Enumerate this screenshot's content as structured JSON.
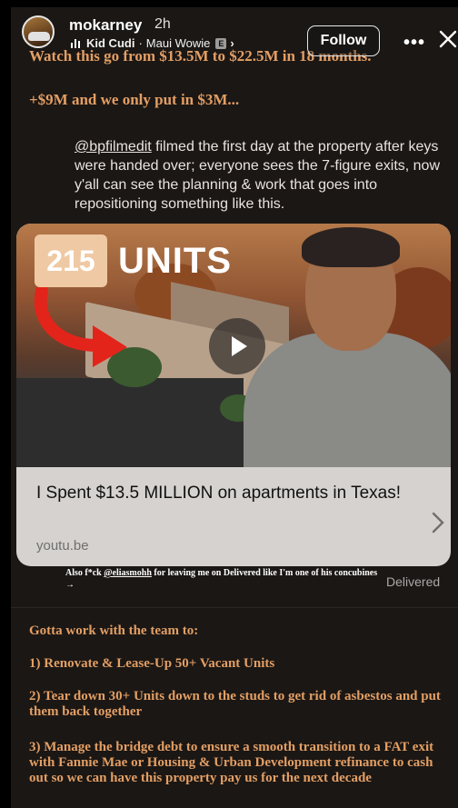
{
  "header": {
    "username": "mokarney",
    "time": "2h",
    "music_artist": "Kid Cudi",
    "music_separator": "·",
    "music_track": "Maui Wowie",
    "explicit_badge": "E",
    "music_chevron": "›",
    "follow_label": "Follow",
    "more_glyph": "•••",
    "icons": [
      "avatar",
      "music-bars-icon",
      "explicit-icon",
      "more-icon",
      "close-icon"
    ]
  },
  "post": {
    "headline": "Watch this go from $13.5M to $22.5M in 18 months.",
    "subline": "+$9M and we only put in $3M...",
    "quote_mention": "@bpfilmedit",
    "quote_body": " filmed the first day at the property after keys were handed over; everyone sees the 7-figure exits, now y'all can see the planning & work that goes into repositioning something like this."
  },
  "youtube_card": {
    "badge_number": "215",
    "badge_label": "UNITS",
    "title": "I Spent $13.5 MILLION on apartments in Texas!",
    "domain": "youtu.be",
    "icons": [
      "red-arrow-icon",
      "play-icon",
      "chevron-right-icon"
    ]
  },
  "caption": {
    "prefix": "Also f*ck ",
    "mention": "@eliasmohh",
    "suffix": " for leaving me on Delivered like I'm one of his concubines →",
    "delivered": "Delivered"
  },
  "list": {
    "intro": "Gotta work with the team to:",
    "items": [
      "1) Renovate & Lease-Up 50+ Vacant Units",
      "2) Tear down 30+ Units down to the studs to get rid of asbestos and put them back together",
      "3) Manage the bridge debt to ensure a smooth transition to a FAT exit with Fannie Mae or Housing & Urban Development refinance to cash out so we can have this property pay us for the next decade"
    ]
  },
  "colors": {
    "accent_text": "#e39f64",
    "background": "#1b1715",
    "card": "#d5d2cf"
  }
}
